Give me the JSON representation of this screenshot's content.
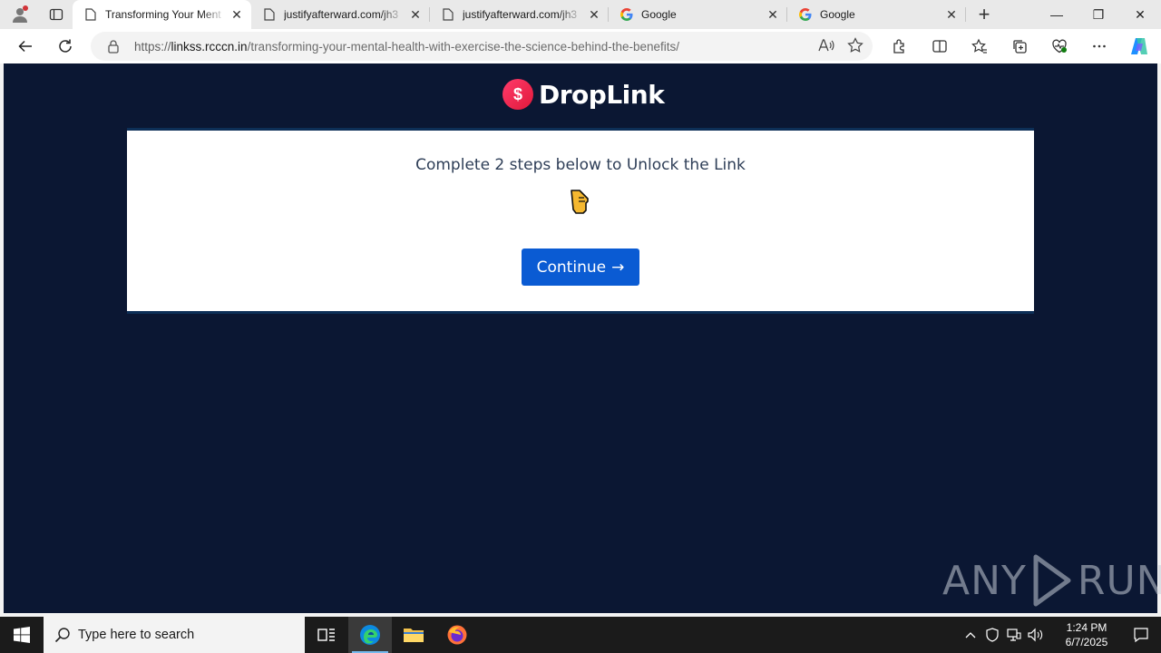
{
  "browser": {
    "tabs": [
      {
        "title": "Transforming Your Ment",
        "favicon": "page-icon",
        "active": true
      },
      {
        "title": "justifyafterward.com/jh3",
        "favicon": "page-icon",
        "active": false
      },
      {
        "title": "justifyafterward.com/jh3",
        "favicon": "page-icon",
        "active": false
      },
      {
        "title": "Google",
        "favicon": "google-icon",
        "active": false
      },
      {
        "title": "Google",
        "favicon": "google-icon",
        "active": false
      }
    ],
    "url_scheme": "https://",
    "url_host": "linkss.rcccn.in",
    "url_path": "/transforming-your-mental-health-with-exercise-the-science-behind-the-benefits/"
  },
  "page": {
    "logo_text": "DropLink",
    "logo_mark": "$",
    "heading": "Complete 2 steps below to Unlock the Link",
    "continue_label": "Continue",
    "continue_arrow": "→",
    "watermark_left": "ANY",
    "watermark_right": "RUN",
    "colors": {
      "page_bg": "#0b1733",
      "button": "#0a5bd3",
      "logo_accent": "#e0193a"
    }
  },
  "taskbar": {
    "search_placeholder": "Type here to search",
    "time": "1:24 PM",
    "date": "6/7/2025"
  }
}
